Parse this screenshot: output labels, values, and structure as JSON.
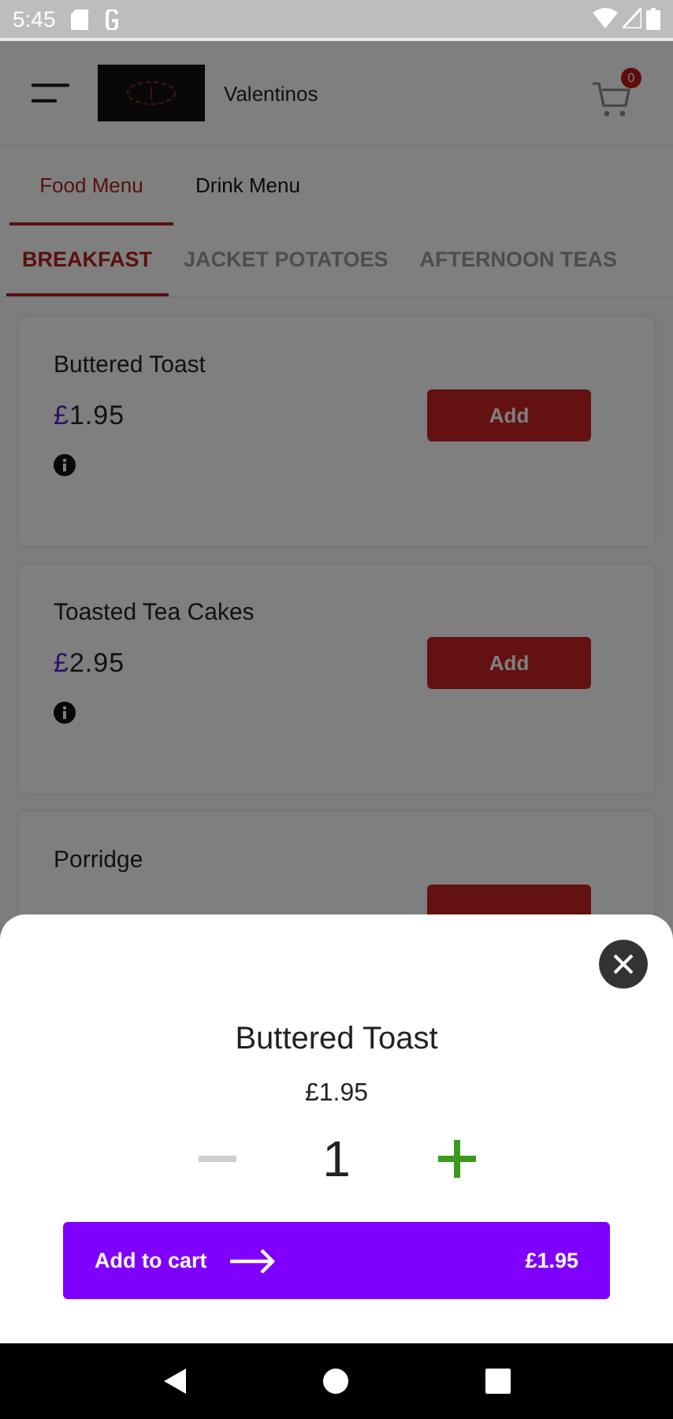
{
  "status_bar": {
    "time": "5:45"
  },
  "header": {
    "title": "Valentinos",
    "cart_count": "0"
  },
  "menu_tabs": [
    {
      "label": "Food Menu",
      "selected": true
    },
    {
      "label": "Drink Menu",
      "selected": false
    }
  ],
  "categories": [
    {
      "label": "BREAKFAST",
      "selected": true
    },
    {
      "label": "JACKET POTATOES",
      "selected": false
    },
    {
      "label": "AFTERNOON TEAS",
      "selected": false
    }
  ],
  "items": [
    {
      "name": "Buttered Toast",
      "currency": "£",
      "price": "1.95",
      "button": "Add",
      "info": true
    },
    {
      "name": "Toasted Tea Cakes",
      "currency": "£",
      "price": "2.95",
      "button": "Add",
      "info": true
    },
    {
      "name": "Porridge"
    }
  ],
  "sheet": {
    "title": "Buttered Toast",
    "price": "£1.95",
    "quantity": "1",
    "decrease_disabled": true,
    "button_label": "Add to cart",
    "button_total": "£1.95"
  }
}
